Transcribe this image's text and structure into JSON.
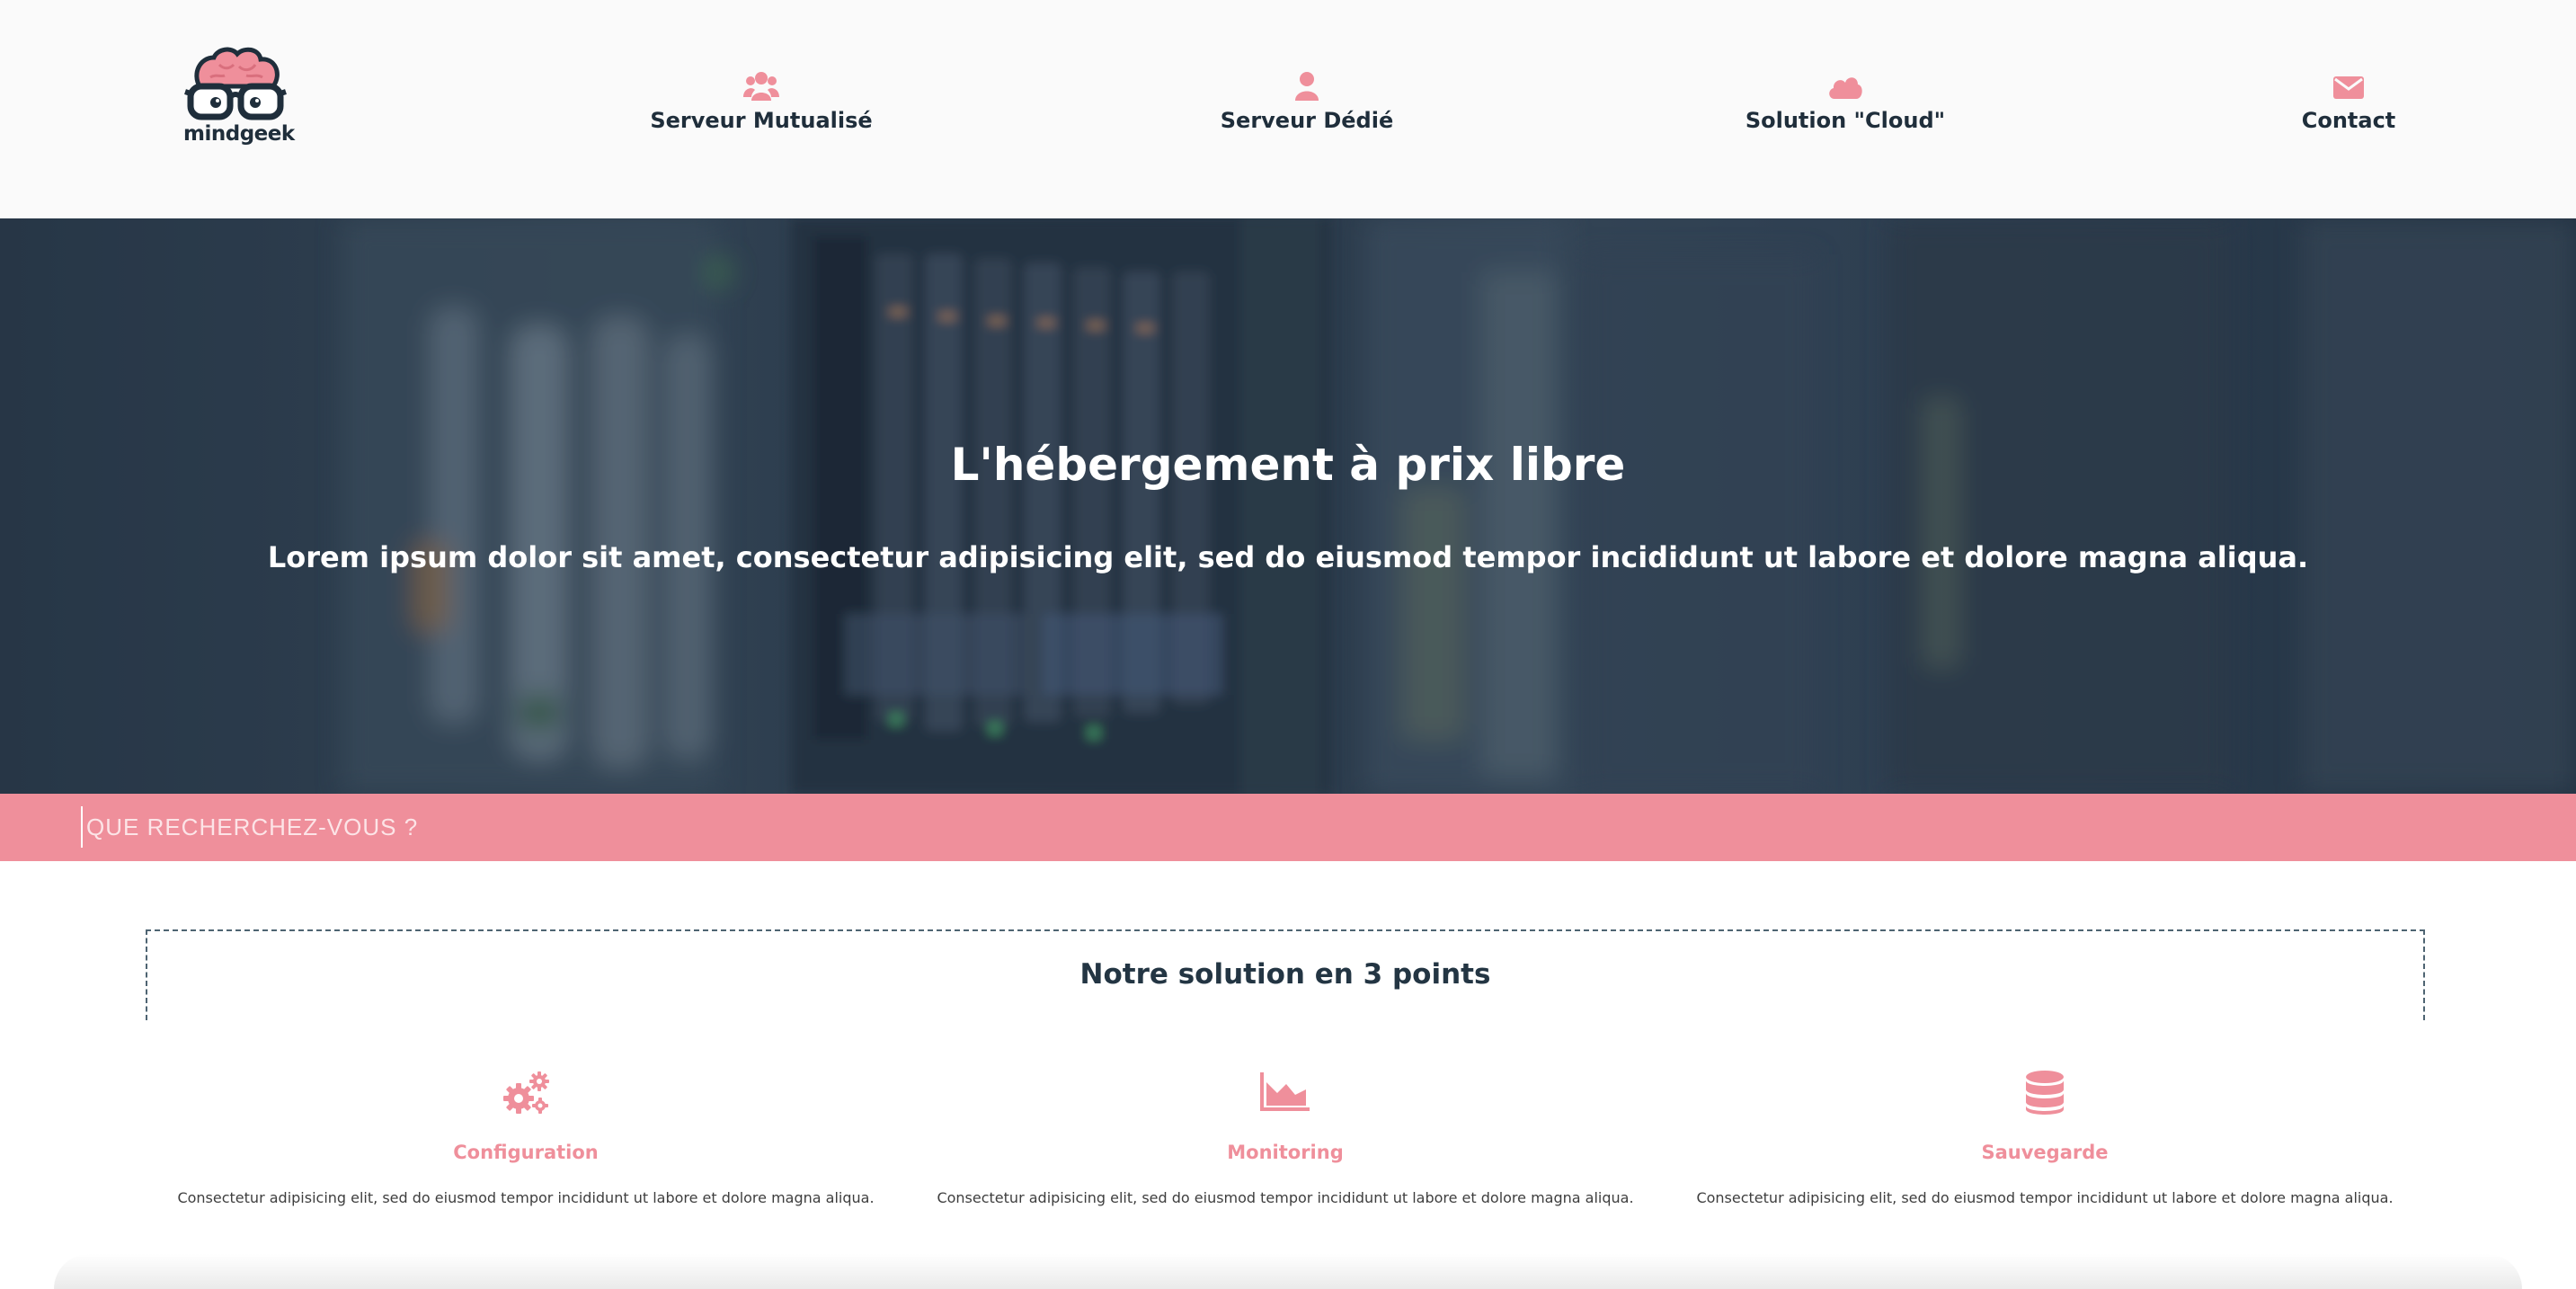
{
  "colors": {
    "accent": "#ef8f9b",
    "dark": "#1f2e3b",
    "nav_bg": "#fafafa"
  },
  "logo": {
    "text": "mindgeek",
    "icon": "brain-glasses-logo"
  },
  "nav": {
    "items": [
      {
        "label": "Serveur Mutualisé",
        "icon": "users-icon"
      },
      {
        "label": "Serveur Dédié",
        "icon": "user-icon"
      },
      {
        "label": "Solution \"Cloud\"",
        "icon": "cloud-icon"
      },
      {
        "label": "Contact",
        "icon": "envelope-icon"
      }
    ]
  },
  "hero": {
    "title": "L'hébergement à prix libre",
    "subtitle": "Lorem ipsum dolor sit amet, consectetur adipisicing elit, sed do eiusmod tempor incididunt ut labore et dolore magna aliqua."
  },
  "search": {
    "placeholder": "QUE RECHERCHEZ-VOUS ?",
    "value": ""
  },
  "solution": {
    "title": "Notre solution en 3 points"
  },
  "features": [
    {
      "title": "Configuration",
      "text": "Consectetur adipisicing elit, sed do eiusmod tempor incididunt ut labore et dolore magna aliqua.",
      "icon": "gears-icon"
    },
    {
      "title": "Monitoring",
      "text": "Consectetur adipisicing elit, sed do eiusmod tempor incididunt ut labore et dolore magna aliqua.",
      "icon": "area-chart-icon"
    },
    {
      "title": "Sauvegarde",
      "text": "Consectetur adipisicing elit, sed do eiusmod tempor incididunt ut labore et dolore magna aliqua.",
      "icon": "database-icon"
    }
  ]
}
